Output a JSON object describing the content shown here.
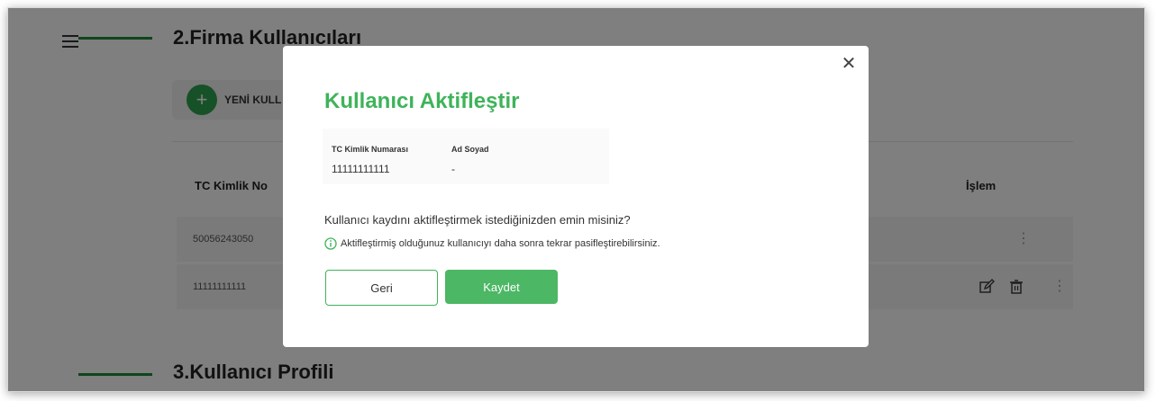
{
  "sections": {
    "firma_users_title": "2.Firma Kullanıcıları",
    "user_profile_title": "3.Kullanıcı Profili"
  },
  "toolbar": {
    "new_user_label": "YENİ KULL"
  },
  "table": {
    "columns": {
      "tc_kimlik": "TC Kimlik No",
      "islem": "İşlem"
    },
    "rows": [
      {
        "tc": "50056243050"
      },
      {
        "tc": "11111111111"
      }
    ]
  },
  "modal": {
    "title": "Kullanıcı Aktifleştir",
    "close_icon": "close-icon",
    "info": {
      "tc_label": "TC Kimlik Numarası",
      "tc_value": "11111111111",
      "name_label": "Ad Soyad",
      "name_value": "-"
    },
    "question": "Kullanıcı kaydını aktifleştirmek istediğinizden emin misiniz?",
    "note": "Aktifleştirmiş olduğunuz kullanıcıyı daha sonra tekrar pasifleştirebilirsiniz.",
    "back_label": "Geri",
    "save_label": "Kaydet"
  },
  "colors": {
    "accent": "#3fb35a",
    "section_line": "#1f8a3a",
    "overlay": "rgba(0,0,0,0.5)"
  }
}
